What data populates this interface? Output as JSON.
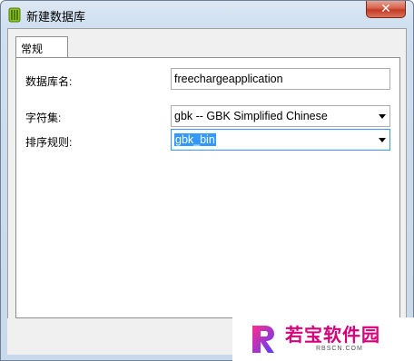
{
  "window": {
    "title": "新建数据库",
    "close_glyph": "✕"
  },
  "tabs": [
    {
      "label": "常规"
    }
  ],
  "form": {
    "dbname_label": "数据库名:",
    "dbname_value": "freechargeapplication",
    "charset_label": "字符集:",
    "charset_value": "gbk -- GBK Simplified Chinese",
    "collation_label": "排序规则:",
    "collation_value": "gbk_bin"
  },
  "watermark": {
    "name": "若宝软件园",
    "site": "RBSCN.COM"
  },
  "icons": {
    "app": "database-icon",
    "dropdown": "chevron-down-icon",
    "logo": "rb-logo-icon"
  },
  "colors": {
    "selection": "#3399ff",
    "close": "#c43b24",
    "watermark": "#d6007a"
  }
}
